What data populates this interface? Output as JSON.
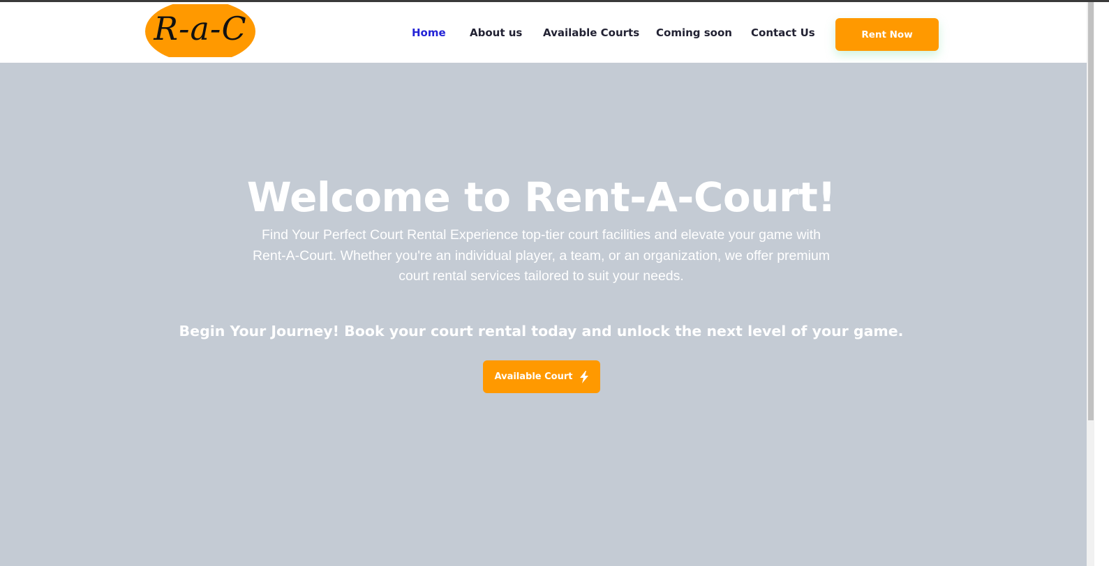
{
  "header": {
    "logo_text": "R-a-C",
    "nav": [
      {
        "label": "Home",
        "active": true
      },
      {
        "label": "About us",
        "active": false
      },
      {
        "label": "Available Courts",
        "active": false
      },
      {
        "label": "Coming soon",
        "active": false
      },
      {
        "label": "Contact Us",
        "active": false
      }
    ],
    "cta_label": "Rent Now"
  },
  "hero": {
    "title": "Welcome to Rent-A-Court!",
    "description": "Find Your Perfect Court Rental Experience top-tier court facilities and elevate your game with Rent-A-Court. Whether you're an individual player, a team, or an organization, we offer premium court rental services tailored to suit your needs.",
    "cta_text": "Begin Your Journey! Book your court rental today and unlock the next level of your game.",
    "button_label": "Available Court",
    "button_icon": "bolt-icon"
  },
  "colors": {
    "accent": "#ff9900",
    "active_nav": "#2323d6",
    "hero_bg": "#c4cbd4",
    "nav_text": "#222233"
  }
}
